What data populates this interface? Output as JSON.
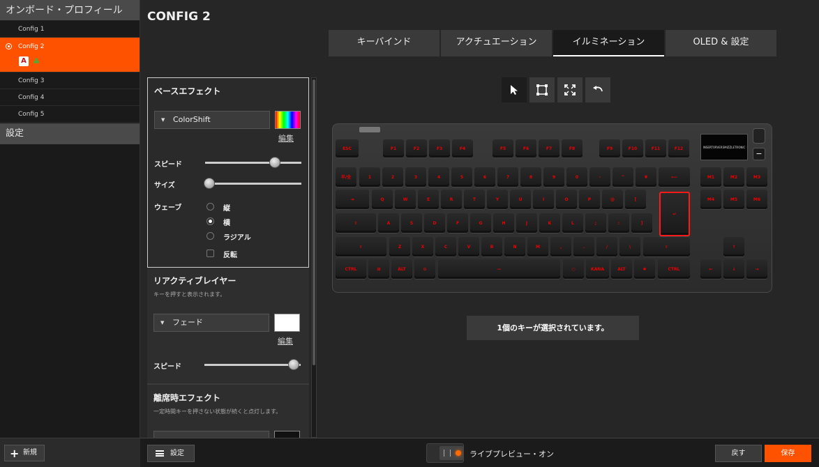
{
  "sidebar": {
    "header": "オンボード・プロフィール",
    "configs": [
      "Config 1",
      "Config 2",
      "Config 3",
      "Config 4",
      "Config 5"
    ],
    "active_config": "Config 2",
    "section": "設定",
    "new_button": "新規"
  },
  "main": {
    "title": "CONFIG 2",
    "tabs": [
      "キーバインド",
      "アクチュエーション",
      "イルミネーション",
      "OLED & 設定"
    ],
    "active_tab": "イルミネーション"
  },
  "base_effect": {
    "title": "ベースエフェクト",
    "effect": "ColorShift",
    "edit": "編集",
    "speed_label": "スピード",
    "speed_value": 0.78,
    "size_label": "サイズ",
    "size_value": 0.0,
    "wave_label": "ウェーブ",
    "wave_options": [
      "縦",
      "横",
      "ラジアル"
    ],
    "wave_selected": "横",
    "reverse_label": "反転"
  },
  "reactive_layer": {
    "title": "リアクティブレイヤー",
    "desc": "キーを押すと表示されます。",
    "effect": "フェード",
    "edit": "編集",
    "speed_label": "スピード",
    "speed_value": 0.96,
    "color": "#ffffff"
  },
  "idle_effect": {
    "title": "離席時エフェクト",
    "desc": "一定時間キーを押さない状態が続くと点灯します。"
  },
  "keyboard": {
    "oled_text": "INSERTORVERSMIZZLETRONIC",
    "key_color": "#ff1a1a",
    "keys": {
      "esc": "ESC",
      "f1": "F1",
      "f2": "F2",
      "f3": "F3",
      "f4": "F4",
      "f5": "F5",
      "f6": "F6",
      "f7": "F7",
      "f8": "F8",
      "f9": "F9",
      "f10": "F10",
      "f11": "F11",
      "f12": "F12",
      "hankaku": "半/全",
      "n1": "1",
      "n2": "2",
      "n3": "3",
      "n4": "4",
      "n5": "5",
      "n6": "6",
      "n7": "7",
      "n8": "8",
      "n9": "9",
      "n0": "0",
      "minus": "-",
      "caret": "^",
      "yen": "¥",
      "bksp": "⟵",
      "m1": "M1",
      "m2": "M2",
      "m3": "M3",
      "m4": "M4",
      "m5": "M5",
      "m6": "M6",
      "tab": "⇥",
      "q": "Q",
      "w": "W",
      "e": "E",
      "r": "R",
      "t": "T",
      "y": "Y",
      "u": "U",
      "i": "I",
      "o": "O",
      "p": "P",
      "at": "@",
      "lbr": "[",
      "enter": "↵",
      "caps": "⇪",
      "a": "A",
      "s": "S",
      "d": "D",
      "f": "F",
      "g": "G",
      "h": "H",
      "j": "J",
      "k": "K",
      "l": "L",
      "semi": ";",
      "colon": ":",
      "rbr": "]",
      "lshift": "⇧",
      "z": "Z",
      "x": "X",
      "c": "C",
      "v": "V",
      "b": "B",
      "n": "N",
      "m": "M",
      "comma": ",",
      "period": ".",
      "slash": "/",
      "bslash": "\\",
      "rshift": "⇧",
      "lctrl": "CTRL",
      "win": "⊞",
      "alt": "ALT",
      "fn": "⊙",
      "space": "—",
      "muhenkan": "○",
      "kana": "KANA",
      "ralt": "ALT",
      "menu": "✱",
      "rctrl": "CTRL",
      "up": "↑",
      "left": "←",
      "down": "↓",
      "right": "→"
    }
  },
  "status_text": "1個のキーが選択されています。",
  "bottom": {
    "settings_button": "設定",
    "live_preview": "ライブプレビュー・オン",
    "back_button": "戻す",
    "save_button": "保存"
  }
}
